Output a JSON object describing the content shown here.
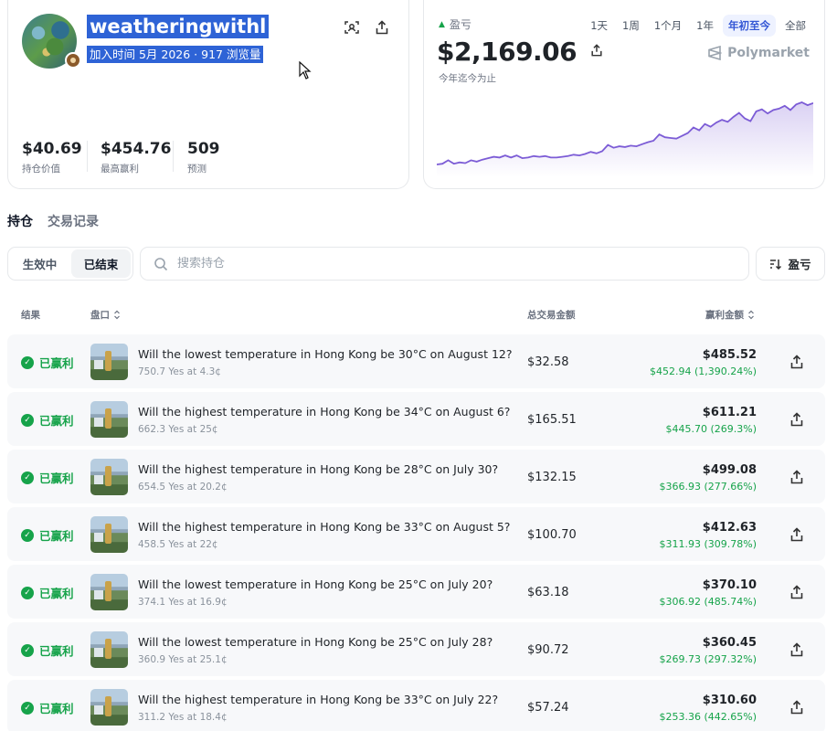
{
  "profile": {
    "username": "weatheringwithl",
    "joined": "加入时间 5月 2026 · 917 浏览量",
    "stats": [
      {
        "value": "$40.69",
        "label": "持仓价值"
      },
      {
        "value": "$454.76",
        "label": "最高赢利"
      },
      {
        "value": "509",
        "label": "预测"
      }
    ]
  },
  "pnl": {
    "label": "盈亏",
    "value": "$2,169.06",
    "sublabel": "今年迄今为止",
    "ranges": [
      "1天",
      "1周",
      "1个月",
      "1年",
      "年初至今",
      "全部"
    ],
    "active_range": "年初至今",
    "brand": "Polymarket",
    "line_color": "#7c5cd6"
  },
  "chart_data": {
    "type": "area",
    "series": [
      {
        "values": [
          2,
          3,
          8,
          3,
          5,
          4,
          8,
          6,
          9,
          11,
          13,
          12,
          15,
          12,
          15,
          11,
          12,
          14,
          13,
          14,
          12,
          12,
          13,
          14,
          16,
          15,
          17,
          20,
          18,
          21,
          30,
          26,
          28,
          27,
          29,
          28,
          31,
          34,
          36,
          45,
          41,
          40,
          39,
          43,
          47,
          55,
          51,
          60,
          56,
          62,
          66,
          63,
          70,
          76,
          68,
          64,
          78,
          81,
          75,
          80,
          82,
          86,
          80,
          88,
          91,
          87,
          90
        ]
      }
    ]
  },
  "tabs": [
    "持仓",
    "交易记录"
  ],
  "segments": [
    "生效中",
    "已结束"
  ],
  "active_segment": "已结束",
  "search": {
    "placeholder": "搜索持仓"
  },
  "sort": {
    "label": "盈亏"
  },
  "table": {
    "headers": {
      "result": "结果",
      "market": "盘口",
      "traded": "总交易金额",
      "won": "赢利金额"
    },
    "rows": [
      {
        "status": "已赢利",
        "question": "Will the lowest temperature in Hong Kong be 30°C on August 12?",
        "sub": "750.7 Yes at 4.3¢",
        "traded": "$32.58",
        "won": "$485.52",
        "won_sub": "$452.94 (1,390.24%)"
      },
      {
        "status": "已赢利",
        "question": "Will the highest temperature in Hong Kong be 34°C on August 6?",
        "sub": "662.3 Yes at 25¢",
        "traded": "$165.51",
        "won": "$611.21",
        "won_sub": "$445.70 (269.3%)"
      },
      {
        "status": "已赢利",
        "question": "Will the highest temperature in Hong Kong be 28°C on July 30?",
        "sub": "654.5 Yes at 20.2¢",
        "traded": "$132.15",
        "won": "$499.08",
        "won_sub": "$366.93 (277.66%)"
      },
      {
        "status": "已赢利",
        "question": "Will the highest temperature in Hong Kong be 33°C on August 5?",
        "sub": "458.5 Yes at 22¢",
        "traded": "$100.70",
        "won": "$412.63",
        "won_sub": "$311.93 (309.78%)"
      },
      {
        "status": "已赢利",
        "question": "Will the lowest temperature in Hong Kong be 25°C on July 20?",
        "sub": "374.1 Yes at 16.9¢",
        "traded": "$63.18",
        "won": "$370.10",
        "won_sub": "$306.92 (485.74%)"
      },
      {
        "status": "已赢利",
        "question": "Will the lowest temperature in Hong Kong be 25°C on July 28?",
        "sub": "360.9 Yes at 25.1¢",
        "traded": "$90.72",
        "won": "$360.45",
        "won_sub": "$269.73 (297.32%)"
      },
      {
        "status": "已赢利",
        "question": "Will the highest temperature in Hong Kong be 33°C on July 22?",
        "sub": "311.2 Yes at 18.4¢",
        "traded": "$57.24",
        "won": "$310.60",
        "won_sub": "$253.36 (442.65%)"
      }
    ]
  }
}
